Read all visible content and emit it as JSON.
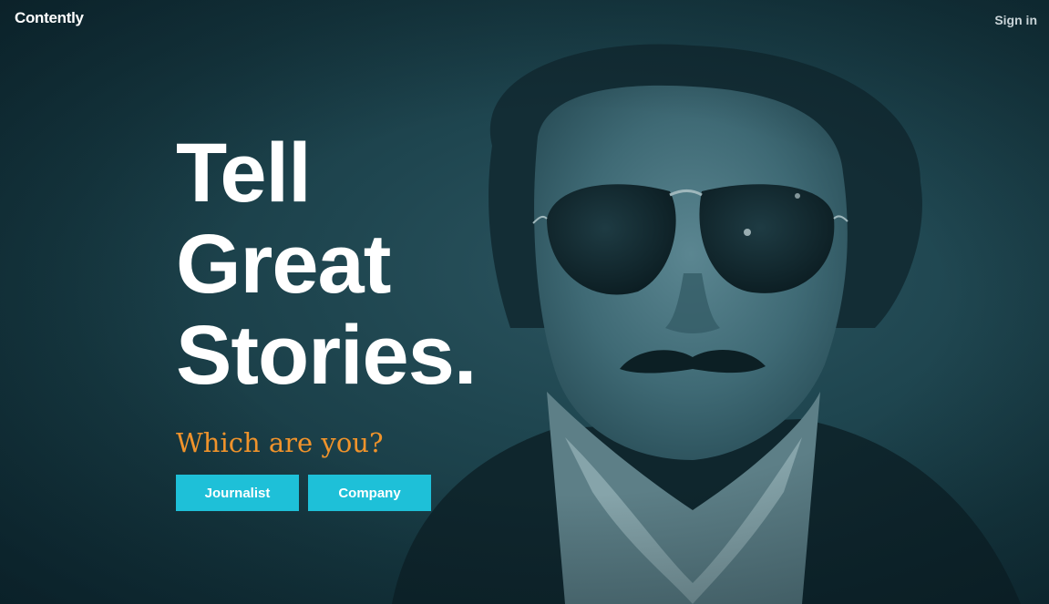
{
  "header": {
    "logo_text": "Contently",
    "signin_label": "Sign in"
  },
  "hero": {
    "headline_lines": [
      "Tell",
      "Great",
      "Stories."
    ],
    "tagline": "Which are you?",
    "buttons": {
      "journalist_label": "Journalist",
      "company_label": "Company"
    }
  },
  "colors": {
    "background": "#1f4650",
    "headline": "#ffffff",
    "tagline_accent": "#f0932b",
    "button_bg": "#1ec0d8",
    "button_text": "#ffffff",
    "signin_text": "#c9d4d8"
  }
}
